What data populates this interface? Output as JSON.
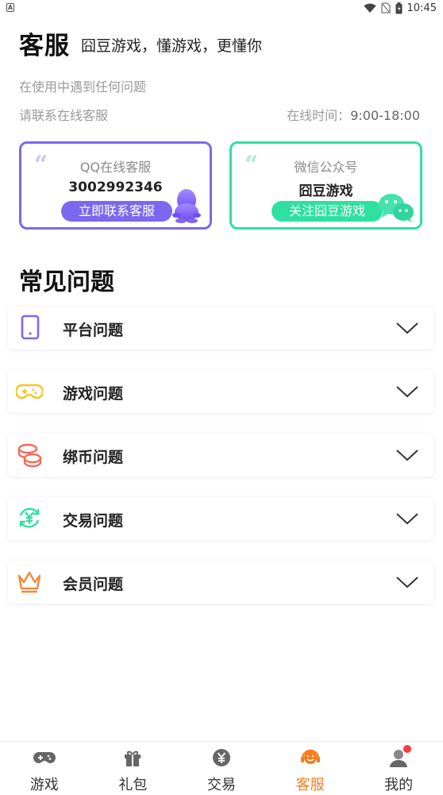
{
  "status_bar": {
    "time": "10:45",
    "badge": "A"
  },
  "header": {
    "title": "客服",
    "subtitle": "囧豆游戏，懂游戏，更懂你",
    "line1": "在使用中遇到任何问题",
    "line2": "请联系在线客服",
    "online_label": "在线时间：",
    "online_hours": "9:00-18:00"
  },
  "cards": {
    "qq": {
      "label": "QQ在线客服",
      "value": "3002992346",
      "button": "立即联系客服",
      "accent": "#7b68ee"
    },
    "wechat": {
      "label": "微信公众号",
      "value": "囧豆游戏",
      "button": "关注囧豆游戏",
      "accent": "#2fe0a1"
    }
  },
  "faq": {
    "title": "常见问题",
    "items": [
      {
        "label": "平台问题",
        "icon": "tablet-icon"
      },
      {
        "label": "游戏问题",
        "icon": "gamepad-icon"
      },
      {
        "label": "绑币问题",
        "icon": "coins-icon"
      },
      {
        "label": "交易问题",
        "icon": "yen-exchange-icon"
      },
      {
        "label": "会员问题",
        "icon": "crown-icon"
      }
    ]
  },
  "tabbar": {
    "active_color": "#ff7a1a",
    "items": [
      {
        "label": "游戏",
        "icon": "gamepad-icon"
      },
      {
        "label": "礼包",
        "icon": "gift-icon"
      },
      {
        "label": "交易",
        "icon": "yen-icon"
      },
      {
        "label": "客服",
        "icon": "headset-icon",
        "active": true
      },
      {
        "label": "我的",
        "icon": "user-icon",
        "badge": true
      }
    ]
  }
}
